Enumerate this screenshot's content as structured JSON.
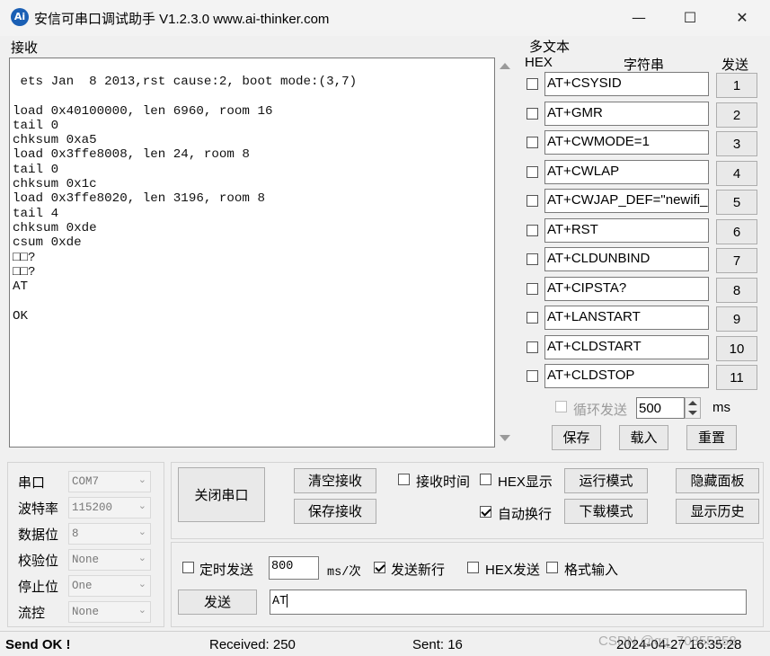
{
  "window": {
    "title": "安信可串口调试助手 V1.2.3.0    www.ai-thinker.com",
    "icon_text": "Ai",
    "controls": {
      "minimize": "—",
      "maximize": "☐",
      "close": "✕"
    }
  },
  "receive": {
    "label": "接收",
    "text": " ets Jan  8 2013,rst cause:2, boot mode:(3,7)\n\nload 0x40100000, len 6960, room 16\ntail 0\nchksum 0xa5\nload 0x3ffe8008, len 24, room 8\ntail 0\nchksum 0x1c\nload 0x3ffe8020, len 3196, room 8\ntail 4\nchksum 0xde\ncsum 0xde\n□□?\n□□?\nAT\n\nOK"
  },
  "multi": {
    "label": "多文本",
    "header_hex": "HEX",
    "header_string": "字符串",
    "header_send": "发送",
    "commands": [
      {
        "value": "AT+CSYSID",
        "button": "1"
      },
      {
        "value": "AT+GMR",
        "button": "2"
      },
      {
        "value": "AT+CWMODE=1",
        "button": "3"
      },
      {
        "value": "AT+CWLAP",
        "button": "4"
      },
      {
        "value": "AT+CWJAP_DEF=\"newifi_",
        "button": "5"
      },
      {
        "value": "AT+RST",
        "button": "6"
      },
      {
        "value": "AT+CLDUNBIND",
        "button": "7"
      },
      {
        "value": "AT+CIPSTA?",
        "button": "8"
      },
      {
        "value": "AT+LANSTART",
        "button": "9"
      },
      {
        "value": "AT+CLDSTART",
        "button": "10"
      },
      {
        "value": "AT+CLDSTOP",
        "button": "11"
      }
    ],
    "loop_label": "循环发送",
    "loop_interval": "500",
    "loop_unit": "ms",
    "save": "保存",
    "load": "载入",
    "reset": "重置"
  },
  "port": {
    "fields": [
      {
        "label": "串口",
        "value": "COM7"
      },
      {
        "label": "波特率",
        "value": "115200"
      },
      {
        "label": "数据位",
        "value": "8"
      },
      {
        "label": "校验位",
        "value": "None"
      },
      {
        "label": "停止位",
        "value": "One"
      },
      {
        "label": "流控",
        "value": "None"
      }
    ]
  },
  "controls": {
    "close_port": "关闭串口",
    "clear_recv": "清空接收",
    "save_recv": "保存接收",
    "recv_time": "接收时间",
    "hex_display": "HEX显示",
    "run_mode": "运行模式",
    "hide_panel": "隐藏面板",
    "auto_wrap": "自动换行",
    "download_mode": "下载模式",
    "show_history": "显示历史"
  },
  "send": {
    "timed_send": "定时发送",
    "interval": "800",
    "interval_unit": "ms/次",
    "send_newline": "发送新行",
    "hex_send": "HEX发送",
    "format_input": "格式输入",
    "send_button": "发送",
    "input_value": "AT"
  },
  "status": {
    "message": "Send OK !",
    "received": "Received: 250",
    "sent": "Sent: 16",
    "timestamp": "2024-04-27 16:35:28",
    "watermark": "CSDN @qq_70855358"
  }
}
